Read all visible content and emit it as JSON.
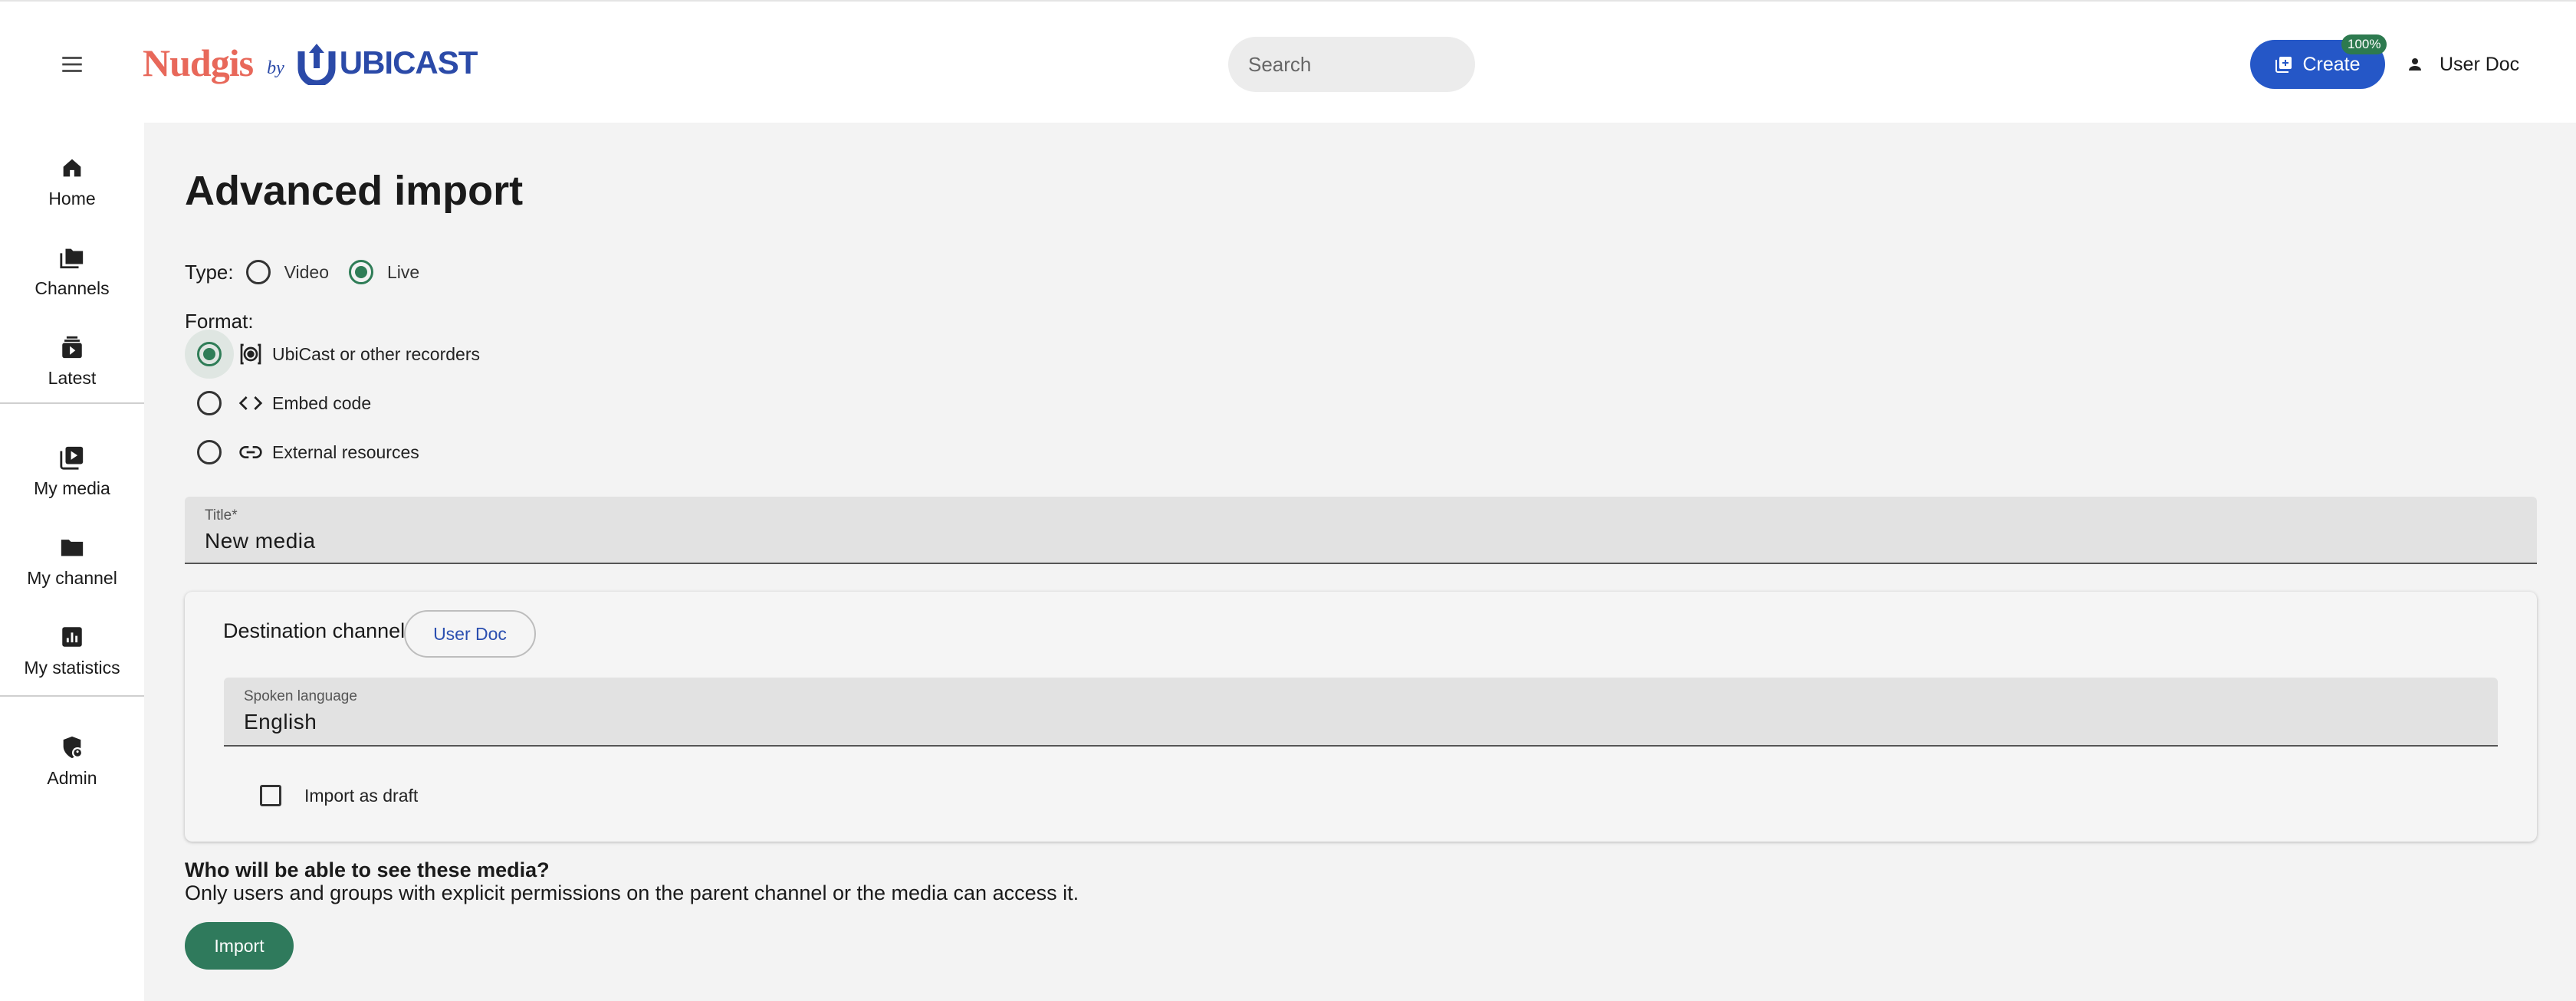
{
  "header": {
    "logo_primary": "Nudgis",
    "logo_by": "by",
    "logo_secondary": "UBICAST",
    "search_placeholder": "Search",
    "create_label": "Create",
    "create_badge": "100%",
    "user_name": "User Doc"
  },
  "sidebar": {
    "items": [
      {
        "label": "Home",
        "icon": "home-icon"
      },
      {
        "label": "Channels",
        "icon": "folders-icon"
      },
      {
        "label": "Latest",
        "icon": "latest-icon"
      },
      {
        "label": "My media",
        "icon": "my-media-icon"
      },
      {
        "label": "My channel",
        "icon": "folder-icon"
      },
      {
        "label": "My statistics",
        "icon": "statistics-icon"
      },
      {
        "label": "Admin",
        "icon": "admin-shield-icon"
      }
    ]
  },
  "main": {
    "title": "Advanced import",
    "type": {
      "label": "Type:",
      "options": [
        {
          "label": "Video",
          "selected": false
        },
        {
          "label": "Live",
          "selected": true
        }
      ]
    },
    "format": {
      "label": "Format:",
      "options": [
        {
          "label": "UbiCast or other recorders",
          "icon": "recorder-icon",
          "selected": true
        },
        {
          "label": "Embed code",
          "icon": "code-icon",
          "selected": false
        },
        {
          "label": "External resources",
          "icon": "link-icon",
          "selected": false
        }
      ]
    },
    "title_field": {
      "label": "Title*",
      "value": "New media"
    },
    "destination": {
      "label": "Destination channel",
      "channel": "User Doc"
    },
    "language_field": {
      "label": "Spoken language",
      "value": "English"
    },
    "draft_label": "Import as draft",
    "visibility_title": "Who will be able to see these media?",
    "visibility_desc": "Only users and groups with explicit permissions on the parent channel or the media can access it.",
    "import_label": "Import"
  },
  "colors": {
    "brand_blue": "#2557c7",
    "accent_green": "#2f7d57",
    "logo_coral": "#e8685a"
  }
}
